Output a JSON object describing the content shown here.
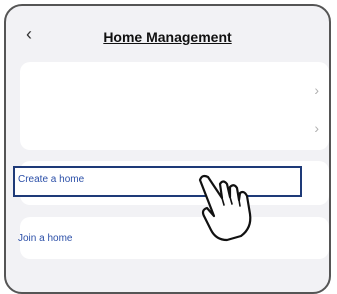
{
  "header": {
    "back_icon": "chevron-left-icon",
    "title": "Home Management"
  },
  "home_list": {
    "items": [
      {
        "label": "",
        "icon": "chevron-right-icon"
      },
      {
        "label": "",
        "icon": "chevron-right-icon"
      }
    ]
  },
  "actions": {
    "create_home": "Create a home",
    "join_home": "Join a home"
  },
  "cursor": {
    "icon": "pointing-hand-icon"
  },
  "colors": {
    "link": "#2b4fa8",
    "highlight_border": "#1e3a78",
    "background": "#f2f2f5"
  }
}
